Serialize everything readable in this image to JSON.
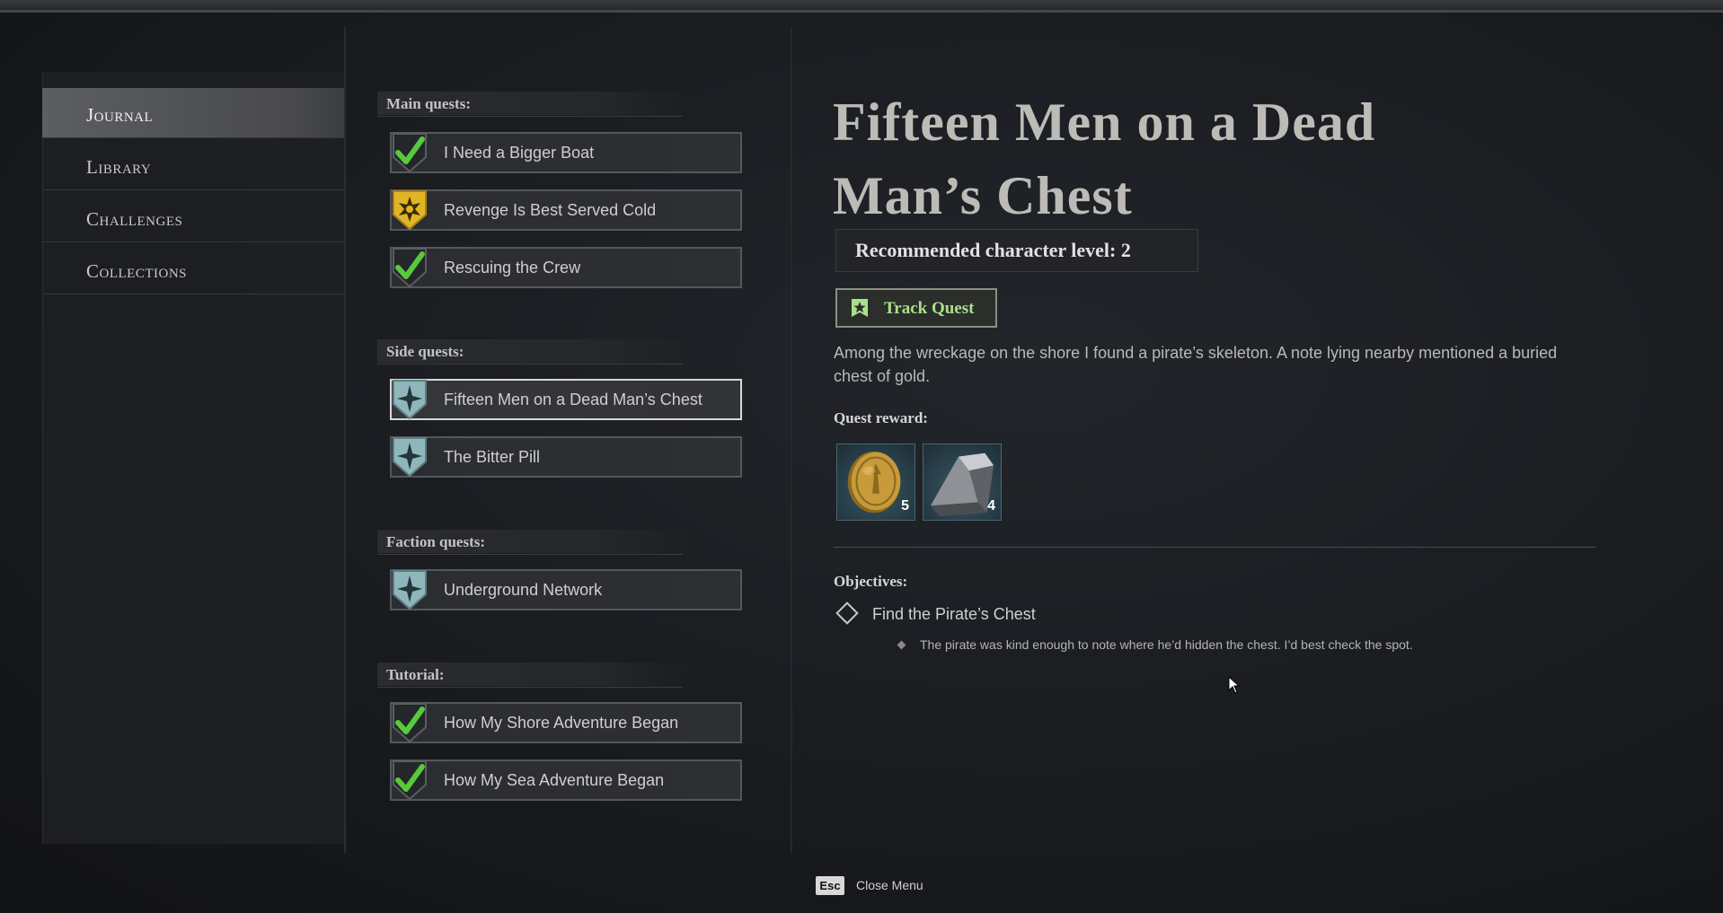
{
  "nav": {
    "items": [
      {
        "label": "Journal",
        "active": true
      },
      {
        "label": "Library",
        "active": false
      },
      {
        "label": "Challenges",
        "active": false
      },
      {
        "label": "Collections",
        "active": false
      }
    ]
  },
  "quests": {
    "main_header": "Main quests:",
    "main": [
      {
        "label": "I Need a Bigger Boat",
        "icon": "check-icon"
      },
      {
        "label": "Revenge Is Best Served Cold",
        "icon": "sun-star-icon"
      },
      {
        "label": "Rescuing the Crew",
        "icon": "check-icon"
      }
    ],
    "side_header": "Side quests:",
    "side": [
      {
        "label": "Fifteen Men on a Dead Man’s Chest",
        "icon": "compass-star-icon",
        "selected": true
      },
      {
        "label": "The Bitter Pill",
        "icon": "compass-star-icon"
      }
    ],
    "faction_header": "Faction quests:",
    "faction": [
      {
        "label": "Underground Network",
        "icon": "compass-star-icon"
      }
    ],
    "tutorial_header": "Tutorial:",
    "tutorial": [
      {
        "label": "How My Shore Adventure Began",
        "icon": "check-icon"
      },
      {
        "label": "How My Sea Adventure Began",
        "icon": "check-icon"
      }
    ]
  },
  "detail": {
    "title": "Fifteen Men on a Dead Man’s Chest",
    "level_text": "Recommended character level: 2",
    "track_label": "Track Quest",
    "description": "Among the wreckage on the shore I found a pirate’s skeleton. A note lying nearby mentioned a buried chest of gold.",
    "reward_label": "Quest reward:",
    "rewards": [
      {
        "icon": "gold-coin-icon",
        "count": "5"
      },
      {
        "icon": "iron-ingot-icon",
        "count": "4"
      }
    ],
    "objectives_label": "Objectives:",
    "objective": "Find the Pirate’s Chest",
    "objective_note": "The pirate was kind enough to note where he’d hidden the chest. I’d best check the spot."
  },
  "footer": {
    "key": "Esc",
    "label": "Close Menu"
  },
  "colors": {
    "track_green": "#a6e28a",
    "check_green": "#59c93c",
    "main_yellow": "#e2b526",
    "side_teal": "#8fb6bb"
  }
}
